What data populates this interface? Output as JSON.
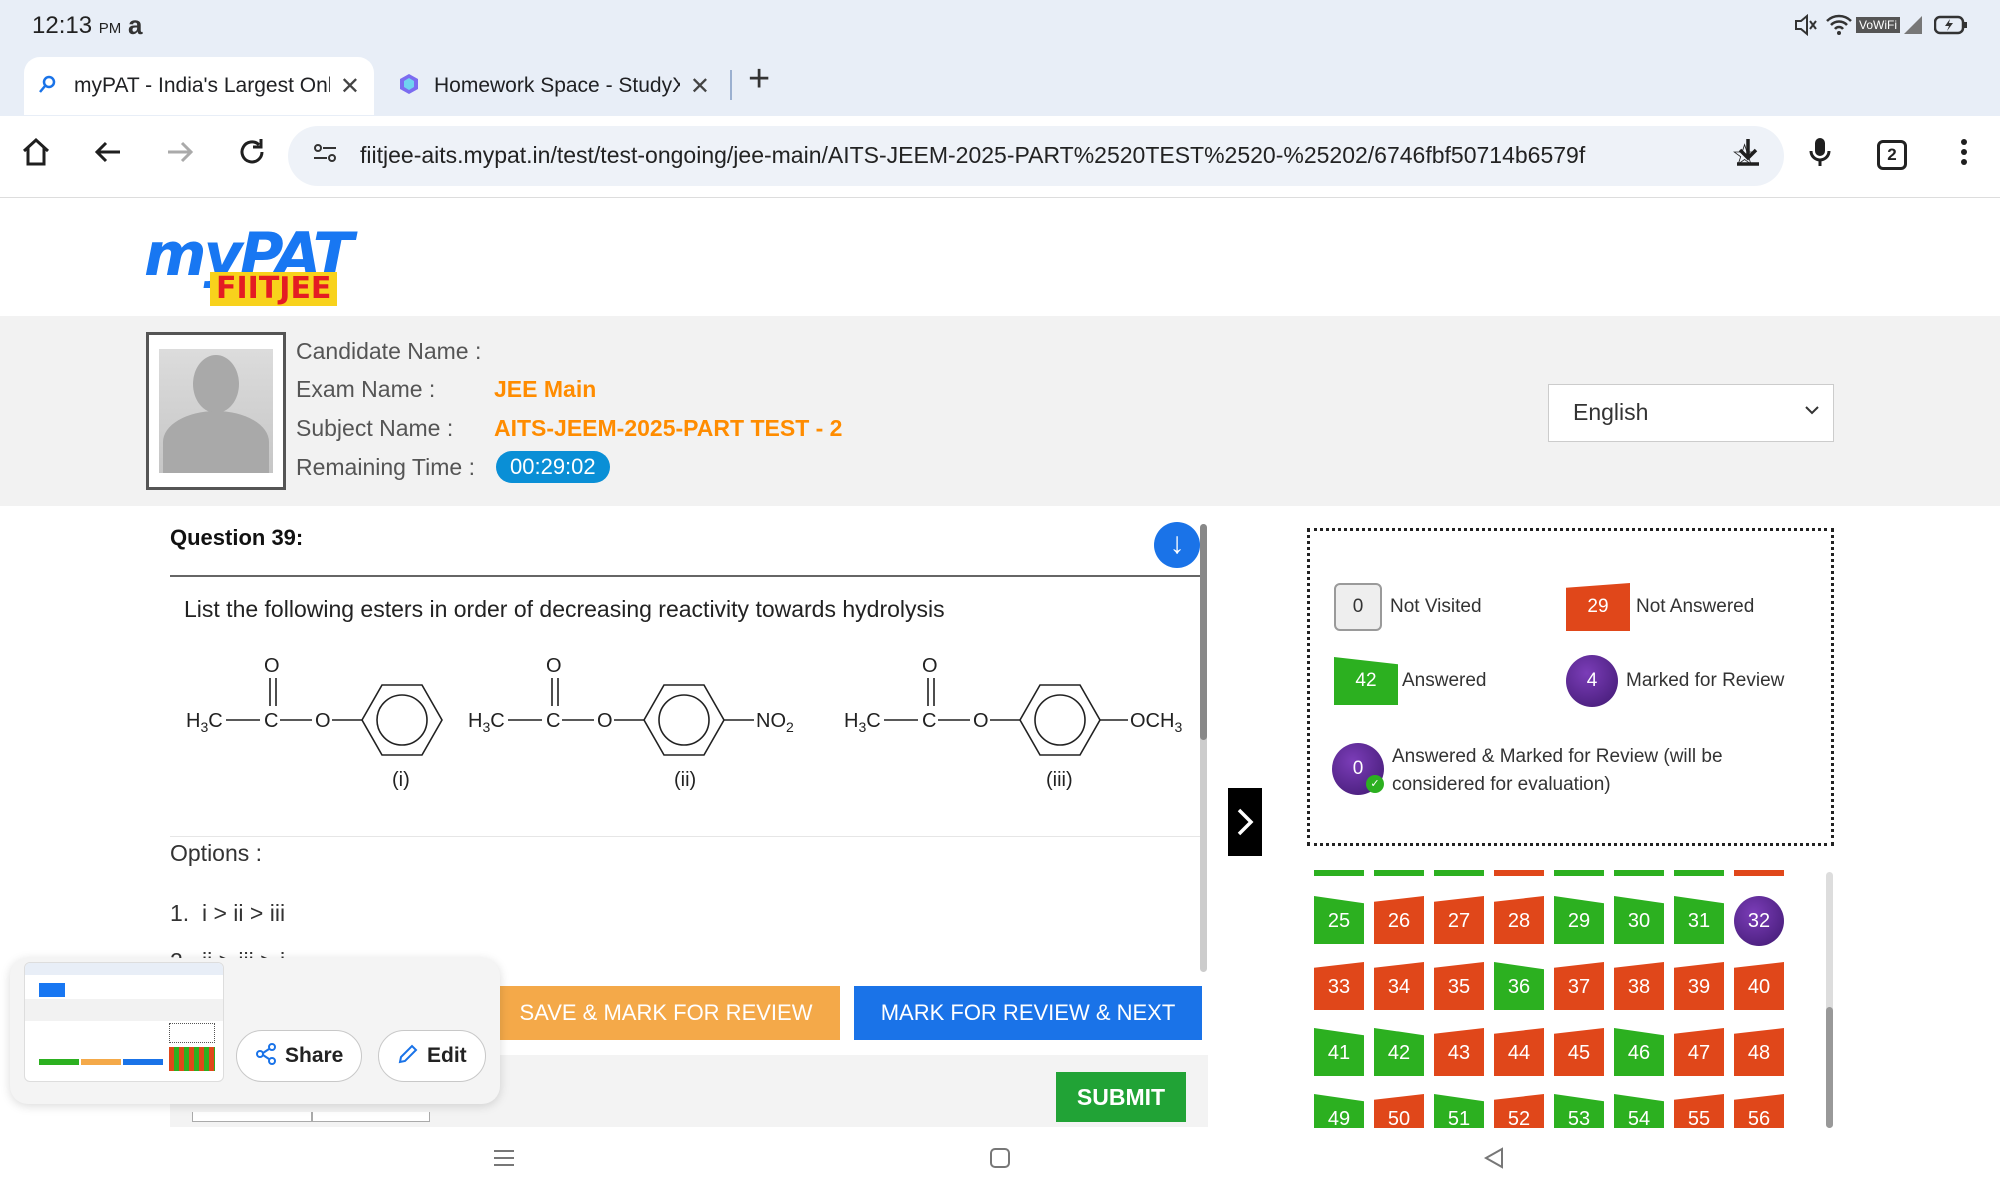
{
  "status_bar": {
    "time": "12:13",
    "ampm": "PM",
    "icons": [
      "amazon-icon",
      "mute-icon",
      "wifi-icon",
      "vowifi-icon",
      "signal-icon",
      "battery-icon"
    ],
    "vowifi": "VoWiFi"
  },
  "tabs": [
    {
      "title": "myPAT - India's Largest Online Test Platform",
      "favicon": "search-favicon",
      "active": true
    },
    {
      "title": "Homework Space - StudyX",
      "favicon": "studyx-favicon",
      "active": false
    }
  ],
  "new_tab_label": "+",
  "address_bar": {
    "url": "fiitjee-aits.mypat.in/test/test-ongoing/jee-main/AITS-JEEM-2025-PART%2520TEST%2520-%25202/6746fbf50714b6579f",
    "tab_count": "2"
  },
  "logo": {
    "my": "myPAT",
    "fiitjee": "FIITJEE"
  },
  "candidate": {
    "name_label": "Candidate Name :",
    "name_value": "",
    "exam_label": "Exam Name :",
    "exam_value": "JEE Main",
    "subject_label": "Subject Name :",
    "subject_value": "AITS-JEEM-2025-PART TEST - 2",
    "time_label": "Remaining Time :",
    "time_value": "00:29:02"
  },
  "language": {
    "selected": "English"
  },
  "question": {
    "title": "Question 39:",
    "text": "List the following esters in order of decreasing reactivity towards hydrolysis",
    "structure_labels": [
      "(i)",
      "(ii)",
      "(iii)"
    ],
    "options_label": "Options :",
    "options": [
      {
        "num": "1.",
        "text": "i > ii > iii"
      },
      {
        "num": "2.",
        "text": "ii > iii > i"
      }
    ]
  },
  "buttons": {
    "save_mark": "SAVE & MARK FOR REVIEW",
    "mark_next": "MARK FOR REVIEW & NEXT",
    "submit": "SUBMIT"
  },
  "legend": {
    "not_visited_count": "0",
    "not_visited_label": "Not Visited",
    "not_answered_count": "29",
    "not_answered_label": "Not Answered",
    "answered_count": "42",
    "answered_label": "Answered",
    "marked_count": "4",
    "marked_label": "Marked for Review",
    "ans_marked_count": "0",
    "ans_marked_label": "Answered & Marked for Review (will be considered for evaluation)"
  },
  "palette": [
    {
      "n": "25",
      "s": "an"
    },
    {
      "n": "26",
      "s": "na"
    },
    {
      "n": "27",
      "s": "na"
    },
    {
      "n": "28",
      "s": "na"
    },
    {
      "n": "29",
      "s": "an"
    },
    {
      "n": "30",
      "s": "an"
    },
    {
      "n": "31",
      "s": "an"
    },
    {
      "n": "32",
      "s": "mr"
    },
    {
      "n": "33",
      "s": "na"
    },
    {
      "n": "34",
      "s": "na"
    },
    {
      "n": "35",
      "s": "na"
    },
    {
      "n": "36",
      "s": "an"
    },
    {
      "n": "37",
      "s": "na"
    },
    {
      "n": "38",
      "s": "na"
    },
    {
      "n": "39",
      "s": "na"
    },
    {
      "n": "40",
      "s": "na"
    },
    {
      "n": "41",
      "s": "an"
    },
    {
      "n": "42",
      "s": "an"
    },
    {
      "n": "43",
      "s": "na"
    },
    {
      "n": "44",
      "s": "na"
    },
    {
      "n": "45",
      "s": "na"
    },
    {
      "n": "46",
      "s": "an"
    },
    {
      "n": "47",
      "s": "na"
    },
    {
      "n": "48",
      "s": "na"
    },
    {
      "n": "49",
      "s": "an"
    },
    {
      "n": "50",
      "s": "na"
    },
    {
      "n": "51",
      "s": "an"
    },
    {
      "n": "52",
      "s": "na"
    },
    {
      "n": "53",
      "s": "an"
    },
    {
      "n": "54",
      "s": "an"
    },
    {
      "n": "55",
      "s": "na"
    },
    {
      "n": "56",
      "s": "na"
    }
  ],
  "palette_top_row_states": [
    "an",
    "an",
    "an",
    "na",
    "an",
    "an",
    "an",
    "na"
  ],
  "screenshot_overlay": {
    "share": "Share",
    "edit": "Edit"
  },
  "colors": {
    "answered": "#2cb020",
    "not_answered": "#e0471a",
    "marked": "#3f1870",
    "accent_orange": "#ff8c00",
    "primary_blue": "#1a73e8",
    "timer_blue": "#0a8fd6"
  }
}
